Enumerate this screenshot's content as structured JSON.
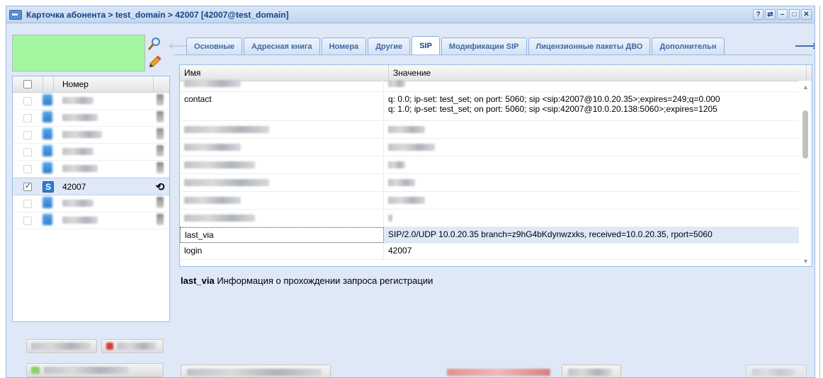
{
  "window": {
    "title": "Карточка абонента > test_domain > 42007 [42007@test_domain]"
  },
  "title_tools": [
    "?",
    "⇄",
    "–",
    "□",
    "✕"
  ],
  "left_panel": {
    "filter_color": "#a4f7a1",
    "grid_header": {
      "number": "Номер"
    },
    "rows": [
      {
        "number": "",
        "blurred": true,
        "checked": false
      },
      {
        "number": "",
        "blurred": true,
        "checked": false
      },
      {
        "number": "",
        "blurred": true,
        "checked": false
      },
      {
        "number": "",
        "blurred": true,
        "checked": false
      },
      {
        "number": "",
        "blurred": true,
        "checked": false
      },
      {
        "number": "42007",
        "blurred": false,
        "checked": true,
        "selected": true
      },
      {
        "number": "",
        "blurred": true,
        "checked": false
      },
      {
        "number": "",
        "blurred": true,
        "checked": false
      }
    ]
  },
  "tabs": [
    "Основные",
    "Адресная книга",
    "Номера",
    "Другие",
    "SIP",
    "Модификации SIP",
    "Лицензионные пакеты ДВО",
    "Дополнительн"
  ],
  "active_tab": "SIP",
  "prop_grid": {
    "col_name": "Имя",
    "col_value": "Значение",
    "rows": [
      {
        "name": "",
        "value": "",
        "blurred": true
      },
      {
        "name": "contact",
        "value": "q: 0.0; ip-set: test_set; on port: 5060; sip <sip:42007@10.0.20.35>;expires=249;q=0.000",
        "value2": "q: 1.0; ip-set: test_set; on port: 5060; sip <sip:42007@10.0.20.138:5060>;expires=1205"
      },
      {
        "name": "",
        "value": "",
        "blurred": true
      },
      {
        "name": "",
        "value": "",
        "blurred": true
      },
      {
        "name": "",
        "value": "",
        "blurred": true
      },
      {
        "name": "",
        "value": "",
        "blurred": true
      },
      {
        "name": "",
        "value": "",
        "blurred": true
      },
      {
        "name": "",
        "value": "",
        "blurred": true
      },
      {
        "name": "last_via",
        "value": "SIP/2.0/UDP 10.0.20.35 branch=z9hG4bKdynwzxks, received=10.0.20.35, rport=5060",
        "selected": true
      },
      {
        "name": "login",
        "value": "42007"
      }
    ]
  },
  "description": {
    "key": "last_via",
    "text": " Информация о прохождении запроса регистрации"
  }
}
